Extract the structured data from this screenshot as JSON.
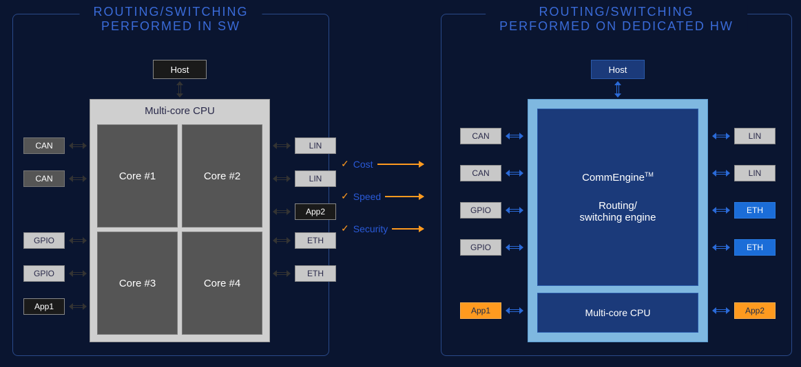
{
  "left": {
    "title_l1": "ROUTING/SWITCHING",
    "title_l2": "PERFORMED IN SW",
    "host": "Host",
    "cpu_title": "Multi-core CPU",
    "cores": [
      "Core #1",
      "Core #2",
      "Core #3",
      "Core #4"
    ],
    "ports_left": [
      {
        "label": "CAN",
        "cls": "chip-dark"
      },
      {
        "label": "CAN",
        "cls": "chip-dark"
      },
      {
        "label": "GPIO",
        "cls": "chip-gray"
      },
      {
        "label": "GPIO",
        "cls": "chip-gray"
      },
      {
        "label": "App1",
        "cls": "chip-black"
      }
    ],
    "ports_right": [
      {
        "label": "LIN",
        "cls": "chip-gray"
      },
      {
        "label": "LIN",
        "cls": "chip-gray"
      },
      {
        "label": "App2",
        "cls": "chip-black"
      },
      {
        "label": "ETH",
        "cls": "chip-gray"
      },
      {
        "label": "ETH",
        "cls": "chip-gray"
      }
    ]
  },
  "middle": {
    "items": [
      "Cost",
      "Speed",
      "Security"
    ]
  },
  "right": {
    "title_l1": "ROUTING/SWITCHING",
    "title_l2": "PERFORMED ON DEDICATED HW",
    "host": "Host",
    "engine_name": "CommEngine",
    "engine_tm": "TM",
    "engine_desc_l1": "Routing/",
    "engine_desc_l2": "switching engine",
    "mc_cpu": "Multi-core CPU",
    "ports_left": [
      {
        "label": "CAN",
        "cls": "chip-gray"
      },
      {
        "label": "CAN",
        "cls": "chip-gray"
      },
      {
        "label": "GPIO",
        "cls": "chip-gray"
      },
      {
        "label": "GPIO",
        "cls": "chip-gray"
      },
      {
        "label": "App1",
        "cls": "chip-orange"
      }
    ],
    "ports_right": [
      {
        "label": "LIN",
        "cls": "chip-gray"
      },
      {
        "label": "LIN",
        "cls": "chip-gray"
      },
      {
        "label": "ETH",
        "cls": "chip-blue"
      },
      {
        "label": "ETH",
        "cls": "chip-blue"
      },
      {
        "label": "App2",
        "cls": "chip-orange"
      }
    ]
  }
}
